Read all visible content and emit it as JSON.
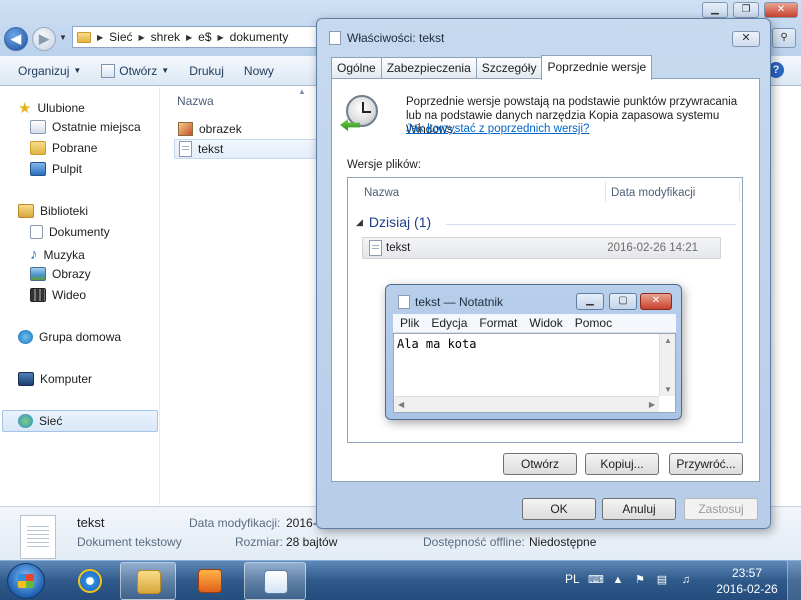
{
  "explorer": {
    "address": [
      "Sieć",
      "shrek",
      "e$",
      "dokumenty"
    ],
    "toolbar": {
      "organize": "Organizuj",
      "open": "Otwórz",
      "print": "Drukuj",
      "new_folder": "Nowy"
    },
    "sidebar": {
      "favorites": "Ulubione",
      "recent": "Ostatnie miejsca",
      "downloads": "Pobrane",
      "desktop": "Pulpit",
      "libraries": "Biblioteki",
      "documents": "Dokumenty",
      "music": "Muzyka",
      "pictures": "Obrazy",
      "videos": "Wideo",
      "homegroup": "Grupa domowa",
      "computer": "Komputer",
      "network": "Sieć"
    },
    "filelist": {
      "column_name": "Nazwa",
      "files": [
        "obrazek",
        "tekst"
      ]
    },
    "details": {
      "name": "tekst",
      "type": "Dokument tekstowy",
      "modified_label": "Data modyfikacji:",
      "modified_value": "2016-0",
      "size_label": "Rozmiar:",
      "size_value": "28 bajtów",
      "offline_label": "Dostępność offline:",
      "offline_value": "Niedostępne"
    }
  },
  "properties": {
    "title": "Właściwości: tekst",
    "close": "✕",
    "tabs": [
      "Ogólne",
      "Zabezpieczenia",
      "Szczegóły",
      "Poprzednie wersje"
    ],
    "info_text": "Poprzednie wersje powstają na podstawie punktów przywracania lub na podstawie danych narzędzia Kopia zapasowa systemu Windows.",
    "info_link": "Jak korzystać z poprzednich wersji?",
    "versions_label": "Wersje plików:",
    "col_name": "Nazwa",
    "col_date": "Data modyfikacji",
    "group": "Dzisiaj (1)",
    "version_name": "tekst",
    "version_date": "2016-02-26 14:21",
    "btn_open": "Otwórz",
    "btn_copy": "Kopiuj...",
    "btn_restore": "Przywróć...",
    "btn_ok": "OK",
    "btn_cancel": "Anuluj",
    "btn_apply": "Zastosuj"
  },
  "notepad": {
    "title": "tekst — Notatnik",
    "menu": [
      "Plik",
      "Edycja",
      "Format",
      "Widok",
      "Pomoc"
    ],
    "content": "Ala ma kota"
  },
  "taskbar": {
    "lang": "PL",
    "time": "23:57",
    "date": "2016-02-26"
  }
}
